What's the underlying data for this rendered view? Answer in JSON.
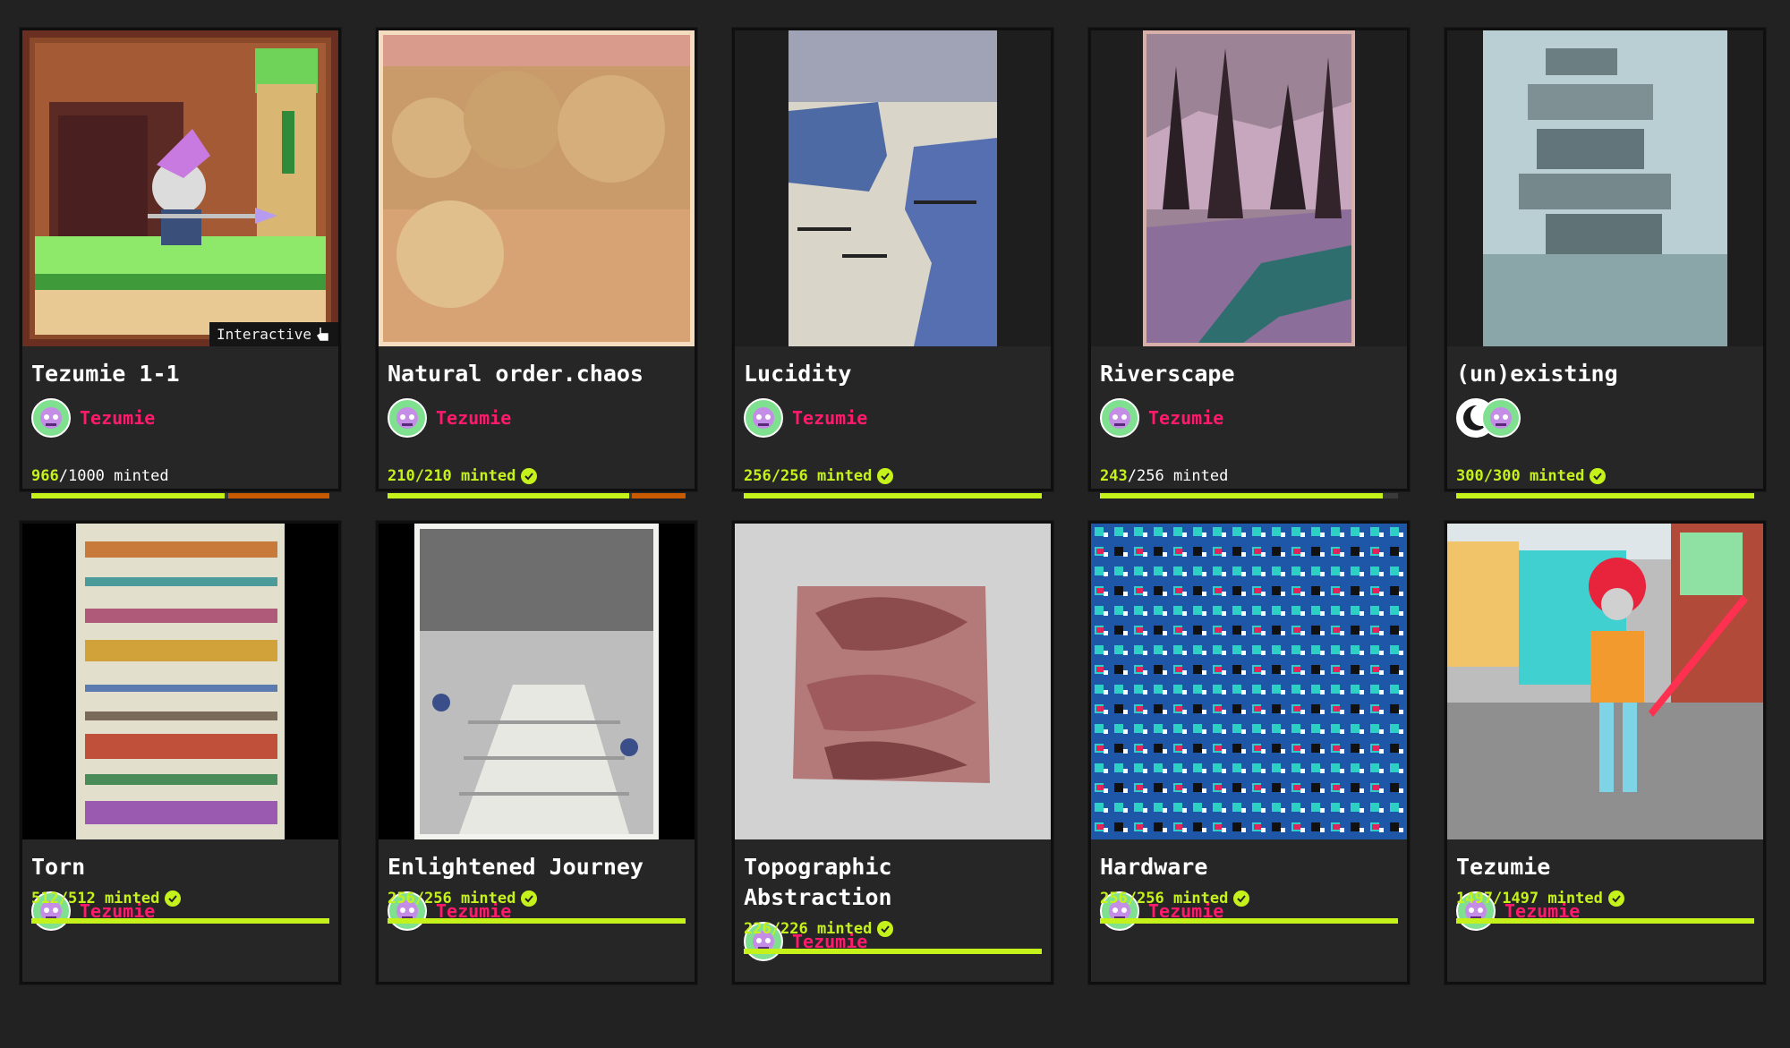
{
  "colors": {
    "accent": "#c6f21b",
    "artist": "#ff1a6c",
    "background": "#222222",
    "card": "#262626"
  },
  "cards": [
    {
      "title": "Tezumie 1-1",
      "artist": "Tezumie",
      "minted": "966",
      "supply": "1000",
      "mint_word": "minted",
      "progress": 0.966,
      "badge": "Interactive",
      "complete": false
    },
    {
      "title": "Natural order.chaos",
      "artist": "Tezumie",
      "minted": "210",
      "supply": "210",
      "mint_word": "minted",
      "progress": 1.0,
      "complete": true
    },
    {
      "title": "Lucidity",
      "artist": "Tezumie",
      "minted": "256",
      "supply": "256",
      "mint_word": "minted",
      "progress": 1.0,
      "complete": true
    },
    {
      "title": "Riverscape",
      "artist": "Tezumie",
      "minted": "243",
      "supply": "256",
      "mint_word": "minted",
      "progress": 0.949,
      "complete": false
    },
    {
      "title": "(un)existing",
      "artist": "",
      "minted": "300",
      "supply": "300",
      "mint_word": "minted",
      "progress": 1.0,
      "complete": true
    },
    {
      "title": "Torn",
      "artist": "Tezumie",
      "minted": "512",
      "supply": "512",
      "mint_word": "minted",
      "progress": 1.0,
      "complete": true
    },
    {
      "title": "Enlightened Journey",
      "artist": "Tezumie",
      "minted": "256",
      "supply": "256",
      "mint_word": "minted",
      "progress": 1.0,
      "complete": true
    },
    {
      "title": "Topographic Abstraction",
      "artist": "Tezumie",
      "minted": "226",
      "supply": "226",
      "mint_word": "minted",
      "progress": 1.0,
      "complete": true
    },
    {
      "title": "Hardware",
      "artist": "Tezumie",
      "minted": "256",
      "supply": "256",
      "mint_word": "minted",
      "progress": 1.0,
      "complete": true
    },
    {
      "title": "Tezumie",
      "artist": "Tezumie",
      "minted": "1497",
      "supply": "1497",
      "mint_word": "minted",
      "progress": 1.0,
      "complete": true
    }
  ],
  "icons": {
    "avatar": "tezumie-avatar-icon",
    "check": "check-circle-icon",
    "pointer": "hand-pointer-icon"
  }
}
